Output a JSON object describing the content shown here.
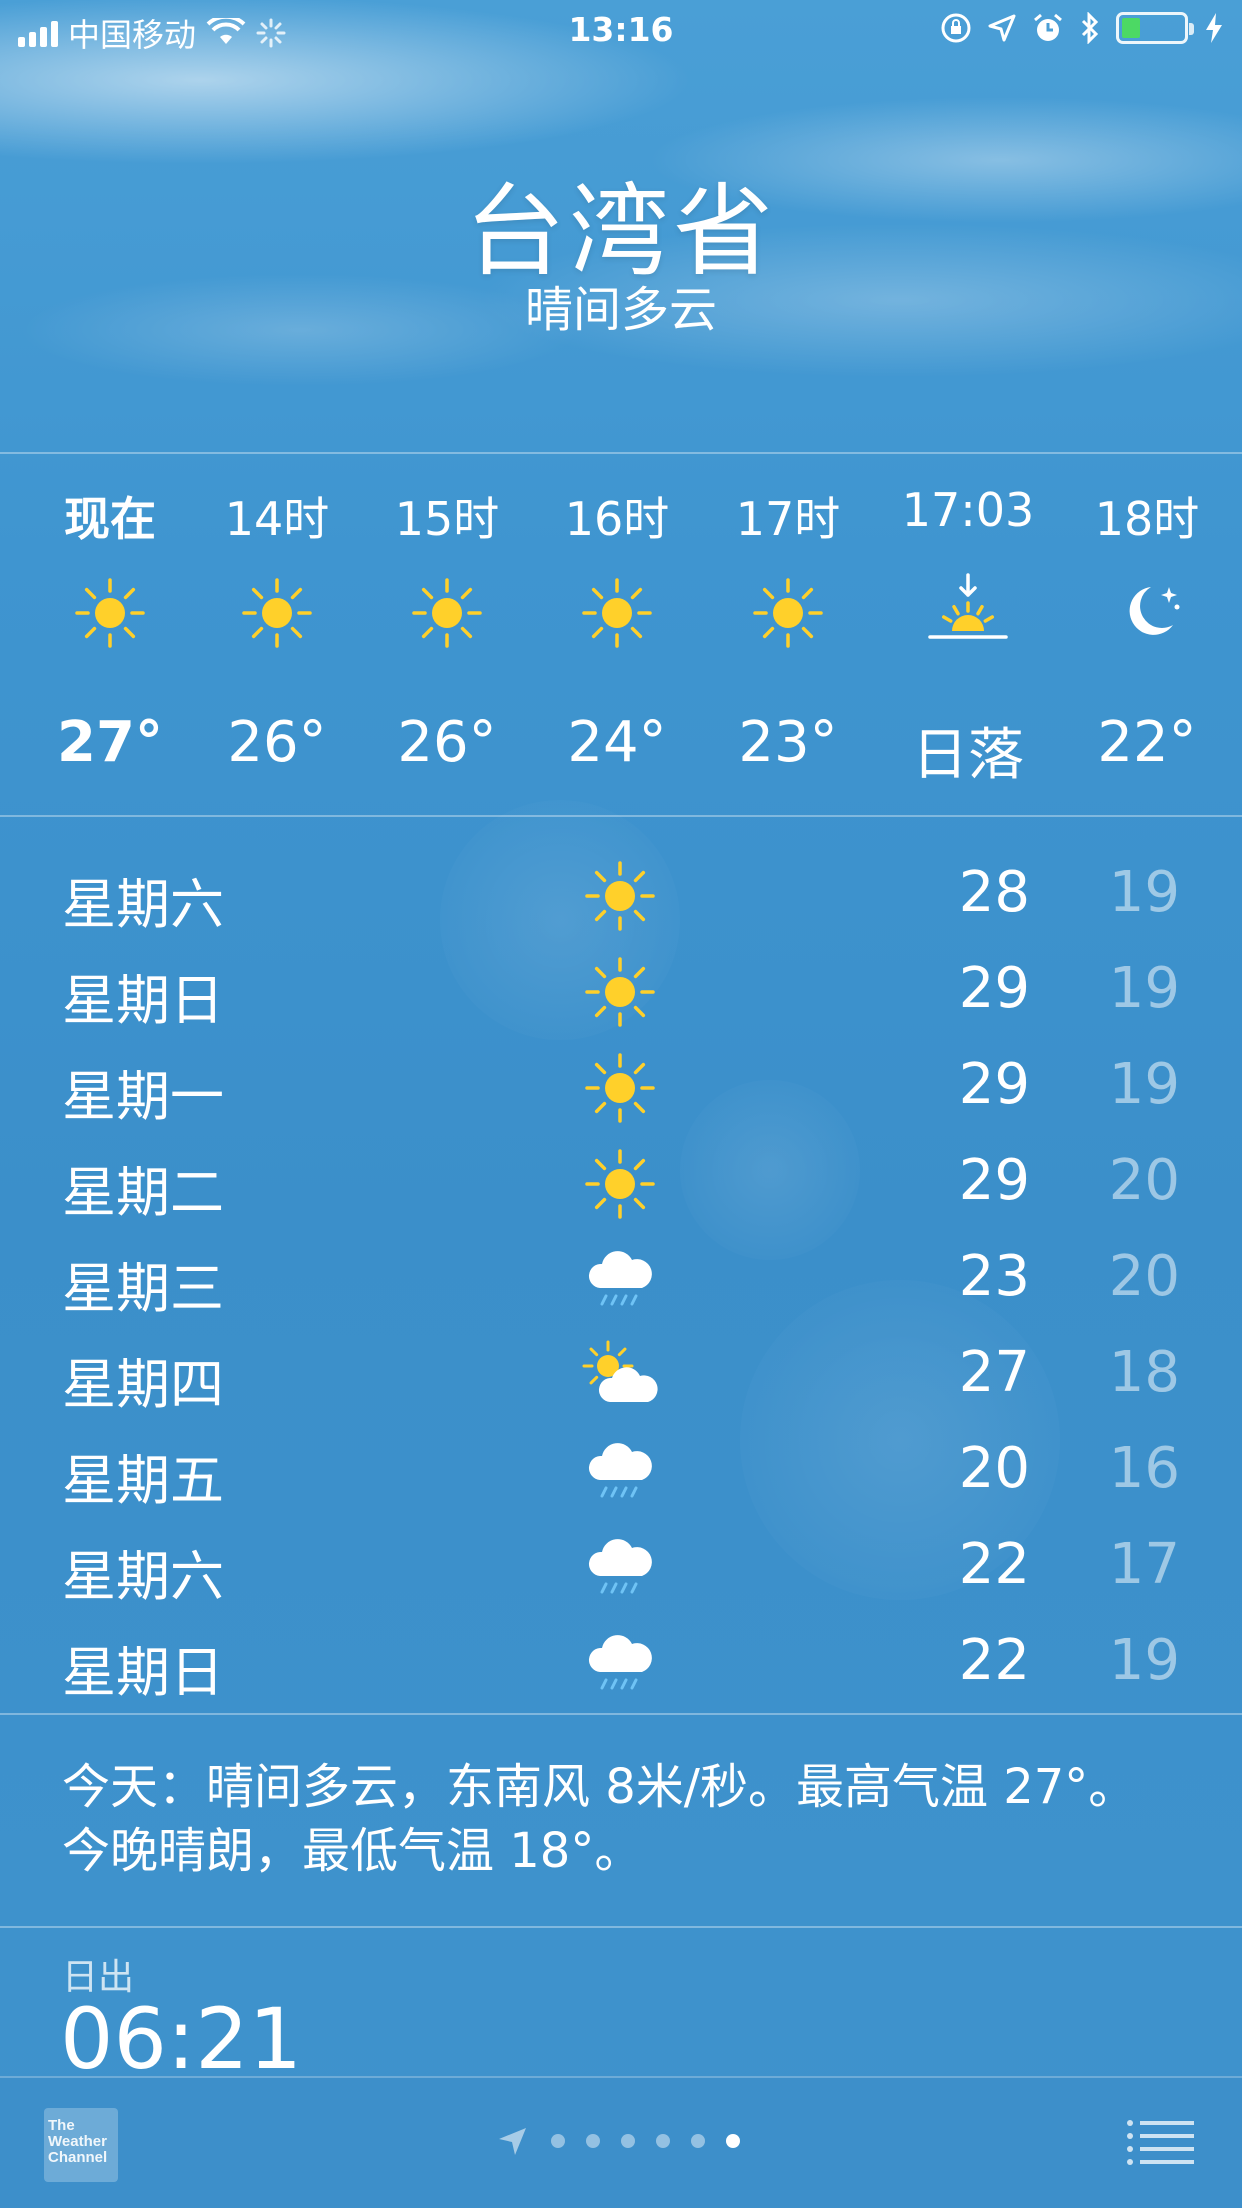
{
  "status_bar": {
    "carrier": "中国移动",
    "time": "13:16"
  },
  "location": {
    "city": "台湾省",
    "condition": "晴间多云"
  },
  "hourly": [
    {
      "label": "现在",
      "icon": "sun-icon",
      "temp": "27°"
    },
    {
      "label": "14时",
      "icon": "sun-icon",
      "temp": "26°"
    },
    {
      "label": "15时",
      "icon": "sun-icon",
      "temp": "26°"
    },
    {
      "label": "16时",
      "icon": "sun-icon",
      "temp": "24°"
    },
    {
      "label": "17时",
      "icon": "sun-icon",
      "temp": "23°"
    },
    {
      "label": "17:03",
      "icon": "sunset-icon",
      "temp": "日落"
    },
    {
      "label": "18时",
      "icon": "moon-icon",
      "temp": "22°"
    }
  ],
  "daily": [
    {
      "day": "星期六",
      "icon": "sun-icon",
      "high": "28",
      "low": "19"
    },
    {
      "day": "星期日",
      "icon": "sun-icon",
      "high": "29",
      "low": "19"
    },
    {
      "day": "星期一",
      "icon": "sun-icon",
      "high": "29",
      "low": "19"
    },
    {
      "day": "星期二",
      "icon": "sun-icon",
      "high": "29",
      "low": "20"
    },
    {
      "day": "星期三",
      "icon": "rain-icon",
      "high": "23",
      "low": "20"
    },
    {
      "day": "星期四",
      "icon": "partly-cloudy-icon",
      "high": "27",
      "low": "18"
    },
    {
      "day": "星期五",
      "icon": "rain-icon",
      "high": "20",
      "low": "16"
    },
    {
      "day": "星期六",
      "icon": "rain-icon",
      "high": "22",
      "low": "17"
    },
    {
      "day": "星期日",
      "icon": "rain-icon",
      "high": "22",
      "low": "19"
    }
  ],
  "summary": "今天：晴间多云，东南风 8米/秒。最高气温 27°。今晚晴朗，最低气温 18°。",
  "sunrise": {
    "label": "日出",
    "value": "06:21"
  },
  "toolbar": {
    "logo_text": "The Weather Channel",
    "page_count": 6,
    "active_page": 6
  },
  "colors": {
    "sun": "#ffd02a",
    "background": "#3f93cd"
  }
}
